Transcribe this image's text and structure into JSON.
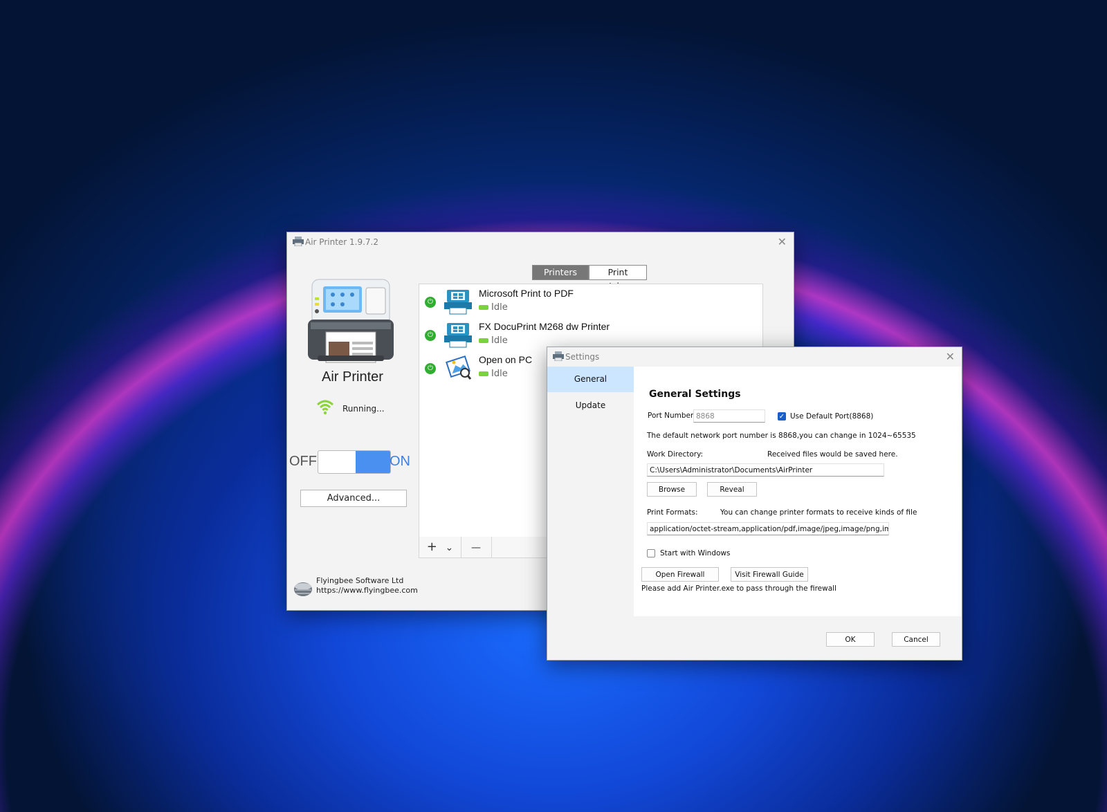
{
  "main_window": {
    "title": "Air Printer 1.9.7.2",
    "close": "✕",
    "app_name": "Air Printer",
    "status": "Running...",
    "toggle_off": "OFF",
    "toggle_on": "ON",
    "advanced_label": "Advanced...",
    "company_name": "Flyingbee Software Ltd",
    "company_url": "https://www.flyingbee.com",
    "tabs": [
      {
        "label": "Printers",
        "active": true
      },
      {
        "label": "Print Jobs",
        "active": false
      }
    ],
    "printers": [
      {
        "name": "Microsoft Print to PDF",
        "status": "Idle",
        "icon": "printer-icon"
      },
      {
        "name": "FX DocuPrint M268 dw Printer",
        "status": "Idle",
        "icon": "printer-icon"
      },
      {
        "name": "Open on PC",
        "status": "Idle",
        "icon": "photo-viewer-icon"
      }
    ],
    "toolbar": {
      "add": "+",
      "add_dropdown": "⌄",
      "remove": "—"
    }
  },
  "settings_window": {
    "title": "Settings",
    "close": "✕",
    "nav": [
      {
        "label": "General",
        "selected": true
      },
      {
        "label": "Update",
        "selected": false
      }
    ],
    "heading": "General Settings",
    "port_label": "Port Number",
    "port_value": "8868",
    "use_default_port_label": "Use Default Port(8868)",
    "use_default_port_checked": true,
    "port_hint": "The default network port number is 8868,you can change in 1024~65535",
    "work_dir_label": "Work Directory:",
    "work_dir_hint": "Received files would be saved here.",
    "work_dir_value": "C:\\Users\\Administrator\\Documents\\AirPrinter",
    "browse_label": "Browse",
    "reveal_label": "Reveal",
    "print_formats_label": "Print Formats:",
    "print_formats_hint": "You can change printer formats to receive kinds of file",
    "print_formats_value": "application/octet-stream,application/pdf,image/jpeg,image/png,image/urf",
    "start_with_windows_label": "Start with Windows",
    "start_with_windows_checked": false,
    "open_firewall_label": "Open Firewall",
    "visit_firewall_guide_label": "Visit Firewall Guide",
    "firewall_hint": "Please add Air Printer.exe to pass through the firewall",
    "ok_label": "OK",
    "cancel_label": "Cancel"
  },
  "colors": {
    "accent": "#4a90f0",
    "selected_nav": "#cde6ff",
    "status_idle": "#7cd23a",
    "power_on": "#2fae2f"
  }
}
